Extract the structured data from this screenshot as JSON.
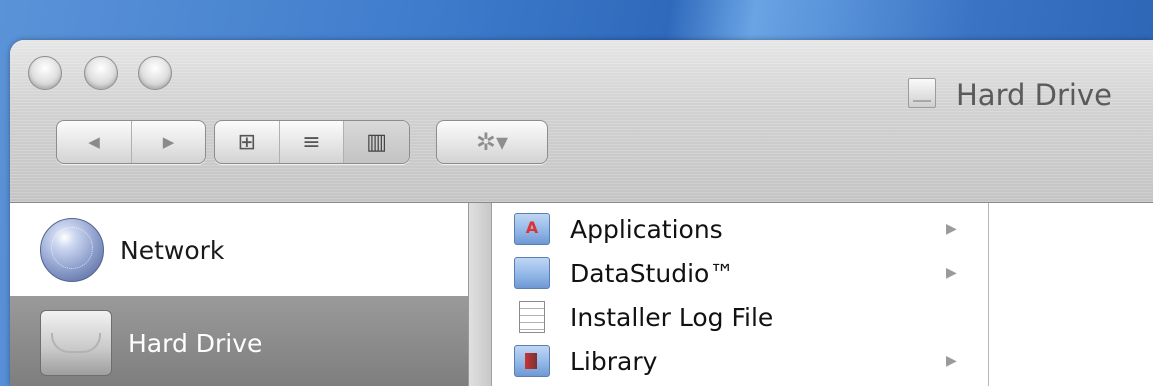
{
  "window": {
    "title": "Hard Drive"
  },
  "toolbar": {
    "back_glyph": "◀",
    "forward_glyph": "▶",
    "view_icon_glyph": "⊞",
    "view_list_glyph": "≡",
    "view_column_glyph": "▥",
    "action_glyph": "✲▾"
  },
  "sidebar": {
    "items": [
      {
        "label": "Network",
        "icon": "network-globe-icon",
        "selected": false
      },
      {
        "label": "Hard Drive",
        "icon": "hard-drive-icon",
        "selected": true
      }
    ]
  },
  "column": {
    "items": [
      {
        "label": "Applications",
        "icon": "applications-folder-icon",
        "has_children": true,
        "arrow": "▶"
      },
      {
        "label": "DataStudio™",
        "icon": "folder-icon",
        "has_children": true,
        "arrow": "▶"
      },
      {
        "label": "Installer Log File",
        "icon": "document-icon",
        "has_children": false,
        "arrow": ""
      },
      {
        "label": "Library",
        "icon": "library-folder-icon",
        "has_children": true,
        "arrow": "▶"
      }
    ]
  },
  "colors": {
    "selection": "#858585",
    "folder": "#8fb5e6",
    "desktop": "#3f7ccc"
  }
}
